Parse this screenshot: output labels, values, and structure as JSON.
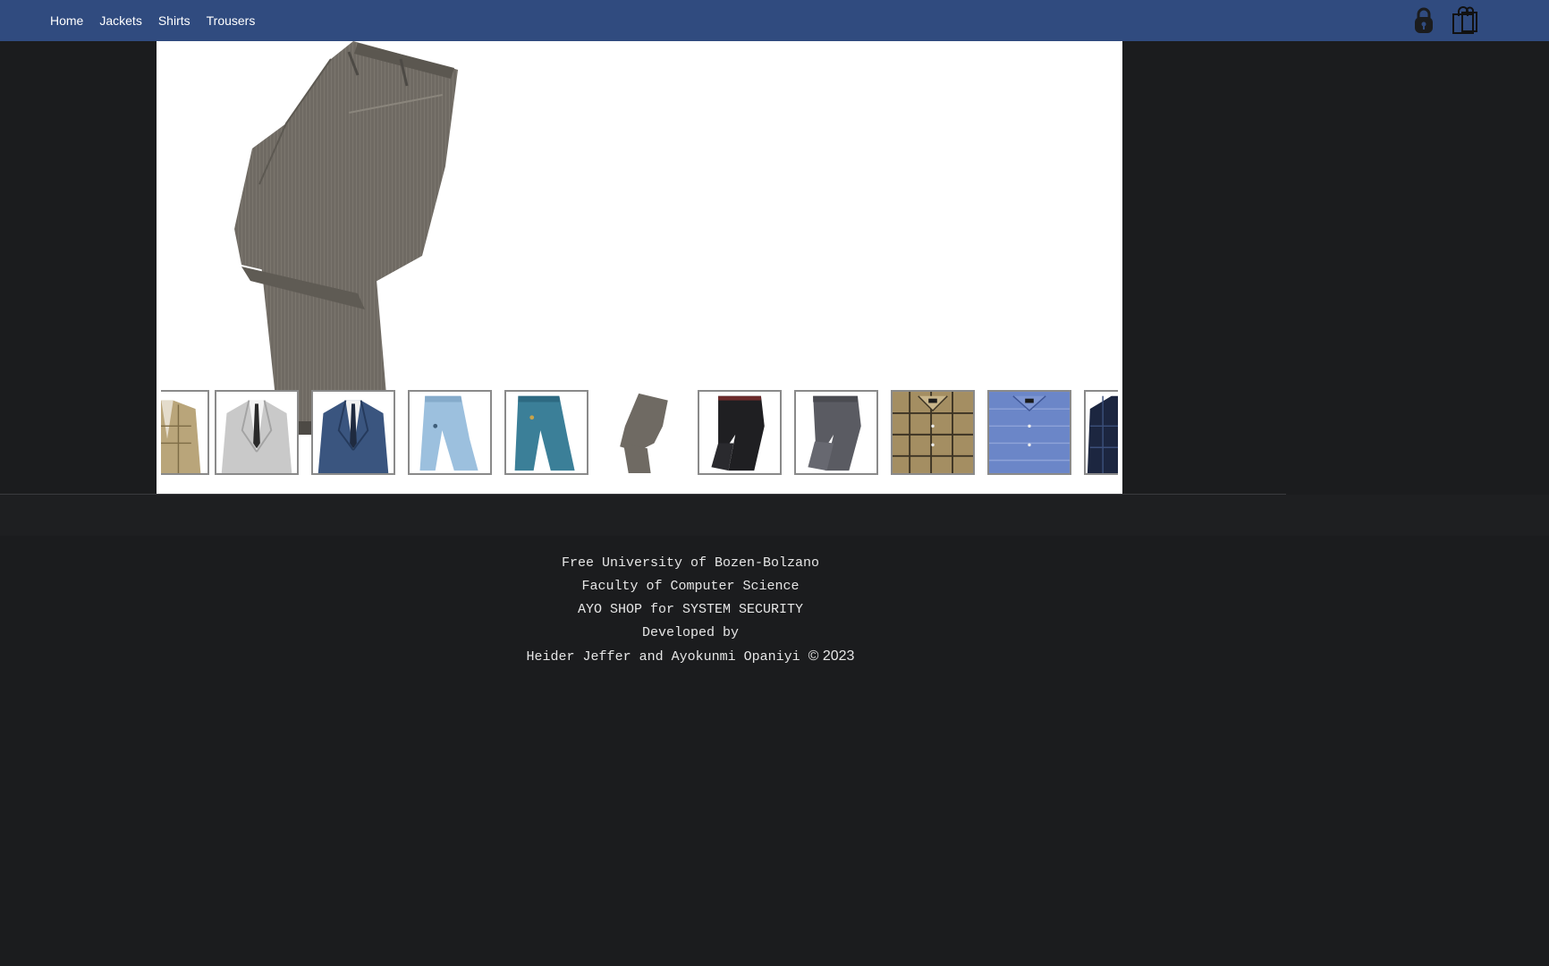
{
  "nav": {
    "links": [
      "Home",
      "Jackets",
      "Shirts",
      "Trousers"
    ],
    "icons": [
      "lock-icon",
      "shopping-bag-icon"
    ]
  },
  "product": {
    "hero_image": "grey-trousers-folded",
    "thumbnails": [
      "tan-check-blazer",
      "light-grey-suit",
      "navy-suit",
      "light-blue-trousers",
      "teal-trousers",
      "grey-trousers",
      "black-trousers",
      "charcoal-trousers",
      "brown-check-shirt",
      "blue-shirt",
      "navy-check-blazer"
    ]
  },
  "footer": {
    "line1": "Free University of Bozen-Bolzano",
    "line2": "Faculty of Computer Science",
    "line3": "AYO SHOP for SYSTEM SECURITY",
    "line4": "Developed by",
    "line5": "Heider Jeffer and Ayokunmi Opaniyi",
    "copyright": "© 2023"
  },
  "colors": {
    "navbar": "#304b7f",
    "page_background": "#1b1c1e",
    "footer_text": "#e6e6e6"
  }
}
